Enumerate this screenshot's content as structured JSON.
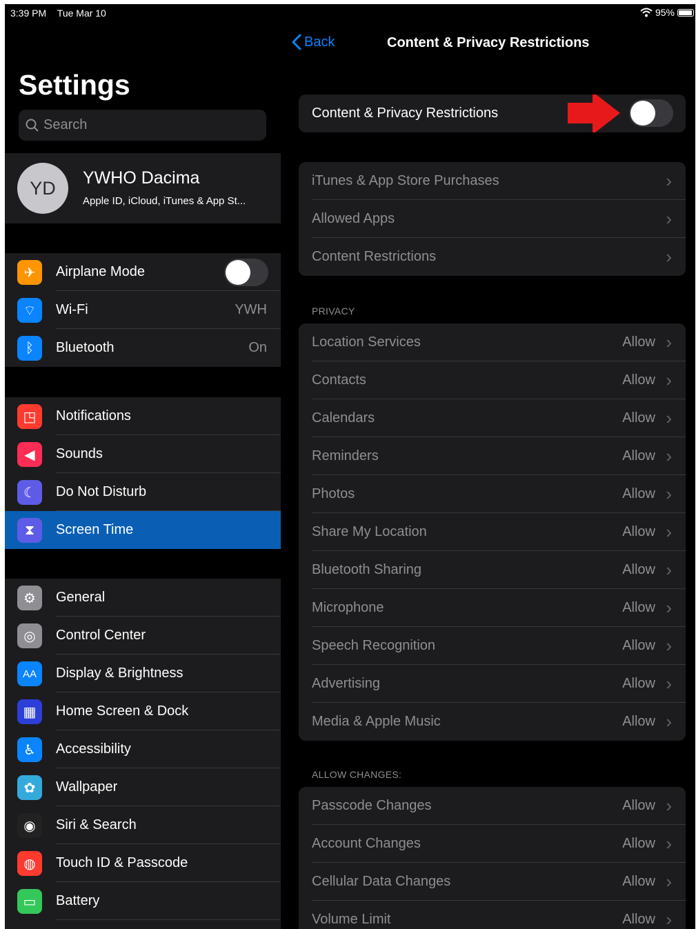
{
  "status": {
    "time": "3:39 PM",
    "date": "Tue Mar 10",
    "battery": "95%"
  },
  "left": {
    "title": "Settings",
    "search_placeholder": "Search",
    "profile": {
      "initials": "YD",
      "name": "YWHO Dacima",
      "subtitle": "Apple ID, iCloud, iTunes & App St..."
    },
    "group1": [
      {
        "label": "Airplane Mode",
        "value": "",
        "icon": "airplane-icon",
        "color": "#ff9500",
        "toggle": false
      },
      {
        "label": "Wi-Fi",
        "value": "YWH",
        "icon": "wifi-icon",
        "color": "#0a84ff"
      },
      {
        "label": "Bluetooth",
        "value": "On",
        "icon": "bluetooth-icon",
        "color": "#0a84ff"
      }
    ],
    "group2": [
      {
        "label": "Notifications",
        "icon": "notifications-icon",
        "color": "#ff3b30"
      },
      {
        "label": "Sounds",
        "icon": "speaker-icon",
        "color": "#ff2d55"
      },
      {
        "label": "Do Not Disturb",
        "icon": "moon-icon",
        "color": "#5e5ce6"
      },
      {
        "label": "Screen Time",
        "icon": "hourglass-icon",
        "color": "#5e5ce6",
        "selected": true
      }
    ],
    "group3": [
      {
        "label": "General",
        "icon": "gear-icon",
        "color": "#8e8e93"
      },
      {
        "label": "Control Center",
        "icon": "switches-icon",
        "color": "#8e8e93"
      },
      {
        "label": "Display & Brightness",
        "icon": "text-size-icon",
        "color": "#0a84ff"
      },
      {
        "label": "Home Screen & Dock",
        "icon": "grid-icon",
        "color": "#2c3fd6"
      },
      {
        "label": "Accessibility",
        "icon": "accessibility-icon",
        "color": "#0a84ff"
      },
      {
        "label": "Wallpaper",
        "icon": "flower-icon",
        "color": "#34aadc"
      },
      {
        "label": "Siri & Search",
        "icon": "siri-icon",
        "color": "#222"
      },
      {
        "label": "Touch ID & Passcode",
        "icon": "fingerprint-icon",
        "color": "#ff3b30"
      },
      {
        "label": "Battery",
        "icon": "battery-icon",
        "color": "#34c759"
      }
    ]
  },
  "right": {
    "back_label": "Back",
    "title": "Content & Privacy Restrictions",
    "main_toggle_label": "Content & Privacy Restrictions",
    "main_toggle_on": false,
    "store_items": [
      "iTunes & App Store Purchases",
      "Allowed Apps",
      "Content Restrictions"
    ],
    "privacy_header": "PRIVACY",
    "privacy_items": [
      {
        "label": "Location Services",
        "value": "Allow"
      },
      {
        "label": "Contacts",
        "value": "Allow"
      },
      {
        "label": "Calendars",
        "value": "Allow"
      },
      {
        "label": "Reminders",
        "value": "Allow"
      },
      {
        "label": "Photos",
        "value": "Allow"
      },
      {
        "label": "Share My Location",
        "value": "Allow"
      },
      {
        "label": "Bluetooth Sharing",
        "value": "Allow"
      },
      {
        "label": "Microphone",
        "value": "Allow"
      },
      {
        "label": "Speech Recognition",
        "value": "Allow"
      },
      {
        "label": "Advertising",
        "value": "Allow"
      },
      {
        "label": "Media & Apple Music",
        "value": "Allow"
      }
    ],
    "changes_header": "ALLOW CHANGES:",
    "changes_items": [
      {
        "label": "Passcode Changes",
        "value": "Allow"
      },
      {
        "label": "Account Changes",
        "value": "Allow"
      },
      {
        "label": "Cellular Data Changes",
        "value": "Allow"
      },
      {
        "label": "Volume Limit",
        "value": "Allow"
      }
    ],
    "arrow_color": "#e8191b"
  }
}
